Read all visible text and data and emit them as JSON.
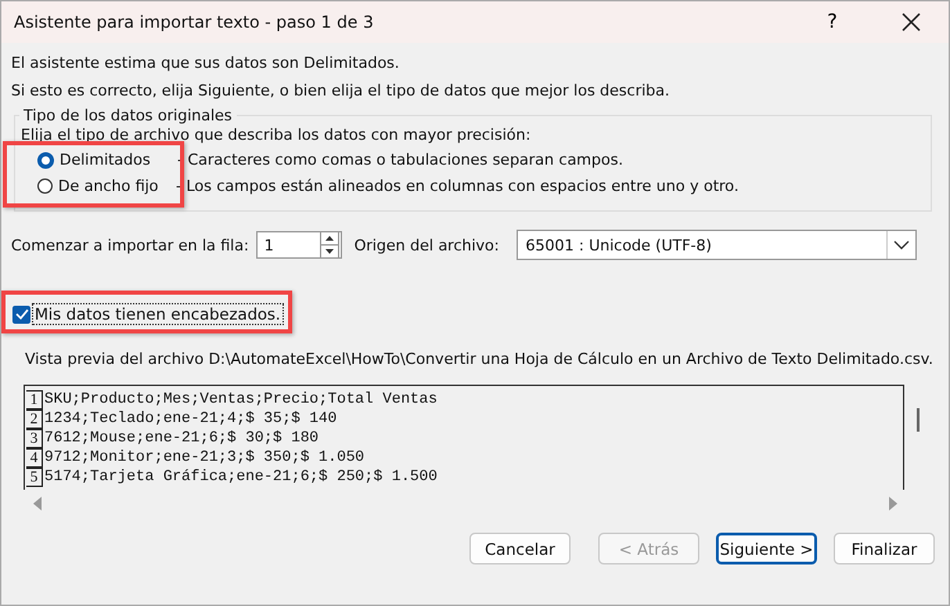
{
  "window": {
    "title": "Asistente para importar texto - paso 1 de 3",
    "help": "?"
  },
  "intro": [
    "El asistente estima que sus datos son Delimitados.",
    "Si esto es correcto, elija Siguiente, o bien elija el tipo de datos que mejor los describa."
  ],
  "group": {
    "title": "Tipo de los datos originales",
    "prompt": "Elija el tipo de archivo que describa los datos con mayor precisión:",
    "highlighted": true,
    "options": [
      {
        "label": "Delimitados",
        "description": "- Caracteres como comas o tabulaciones separan campos.",
        "selected": true
      },
      {
        "label": "De ancho fijo",
        "description": "- Los campos están alineados en columnas con espacios entre uno y otro.",
        "selected": false
      }
    ]
  },
  "start_row": {
    "label": "Comenzar a importar en la fila:",
    "value": "1"
  },
  "origin": {
    "label": "Origen del archivo:",
    "value": "65001 : Unicode (UTF-8)"
  },
  "headers": {
    "label": "Mis datos tienen encabezados.",
    "checked": true,
    "highlighted": true
  },
  "preview": {
    "label": "Vista previa del archivo D:\\AutomateExcel\\HowTo\\Convertir una Hoja de Cálculo en un Archivo de Texto Delimitado.csv.",
    "rows": [
      {
        "number": "1",
        "text": "SKU;Producto;Mes;Ventas;Precio;Total Ventas"
      },
      {
        "number": "2",
        "text": "1234;Teclado;ene-21;4;$ 35;$ 140"
      },
      {
        "number": "3",
        "text": "7612;Mouse;ene-21;6;$ 30;$ 180"
      },
      {
        "number": "4",
        "text": "9712;Monitor;ene-21;3;$ 350;$ 1.050"
      },
      {
        "number": "5",
        "text": "5174;Tarjeta Gráfica;ene-21;6;$ 250;$ 1.500"
      }
    ]
  },
  "buttons": [
    {
      "label": "Cancelar",
      "disabled": false,
      "default": false
    },
    {
      "label": "< Atrás",
      "disabled": true,
      "default": false
    },
    {
      "label": "Siguiente >",
      "disabled": false,
      "default": true
    },
    {
      "label": "Finalizar",
      "disabled": false,
      "default": false
    }
  ]
}
